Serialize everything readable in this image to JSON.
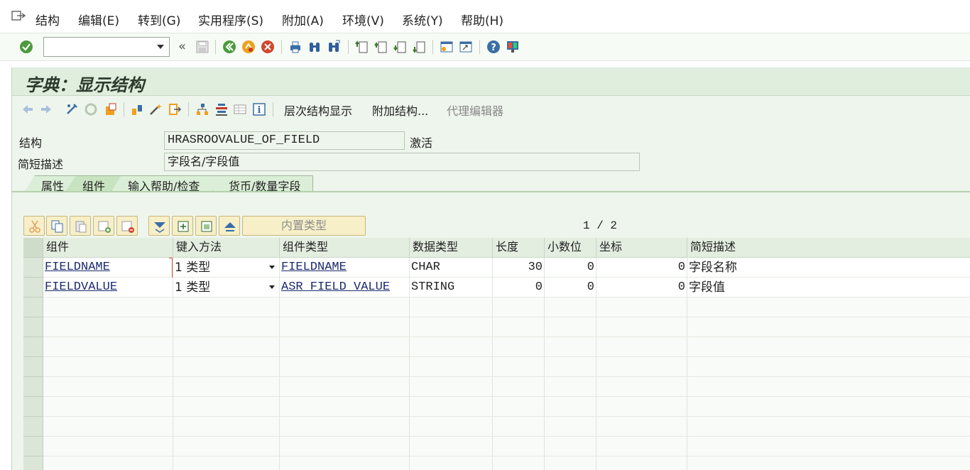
{
  "menubar": {
    "items": [
      "结构",
      "编辑(E)",
      "转到(G)",
      "实用程序(S)",
      "附加(A)",
      "环境(V)",
      "系统(Y)",
      "帮助(H)"
    ]
  },
  "systoolbar": {
    "command_field_value": "",
    "icons": [
      "enter-icon",
      "save-icon",
      "back-icon",
      "exit-icon",
      "cancel-icon",
      "print-icon",
      "find-icon",
      "find-next-icon",
      "first-page-icon",
      "prev-page-icon",
      "next-page-icon",
      "last-page-icon",
      "new-session-icon",
      "shortcut-icon",
      "help-icon",
      "customize-layout-icon"
    ]
  },
  "title": "字典：显示结构",
  "apptoolbar": {
    "hierarchy_label": "层次结构显示",
    "append_label": "附加结构...",
    "proxy_editor_label": "代理编辑器"
  },
  "form": {
    "structure_label": "结构",
    "structure_value": "HRASROOVALUE_OF_FIELD",
    "status": "激活",
    "short_desc_label": "简短描述",
    "short_desc_value": "字段名/字段值"
  },
  "tabs": [
    "属性",
    "组件",
    "输入帮助/检查",
    "货币/数量字段"
  ],
  "active_tab": "组件",
  "table_toolbar": {
    "builtin_type_label": "内置类型",
    "pager": "1 / 2"
  },
  "table": {
    "columns": [
      "组件",
      "键入方法",
      "组件类型",
      "数据类型",
      "长度",
      "小数位",
      "坐标",
      "简短描述"
    ],
    "rows": [
      {
        "component": "FIELDNAME",
        "typing": "1 类型",
        "comp_type": "FIELDNAME",
        "data_type": "CHAR",
        "length": "30",
        "decimals": "0",
        "coord": "0",
        "desc": "字段名称"
      },
      {
        "component": "FIELDVALUE",
        "typing": "1 类型",
        "comp_type": "ASR_FIELD_VALUE",
        "data_type": "STRING",
        "length": "0",
        "decimals": "0",
        "coord": "0",
        "desc": "字段值"
      }
    ]
  }
}
